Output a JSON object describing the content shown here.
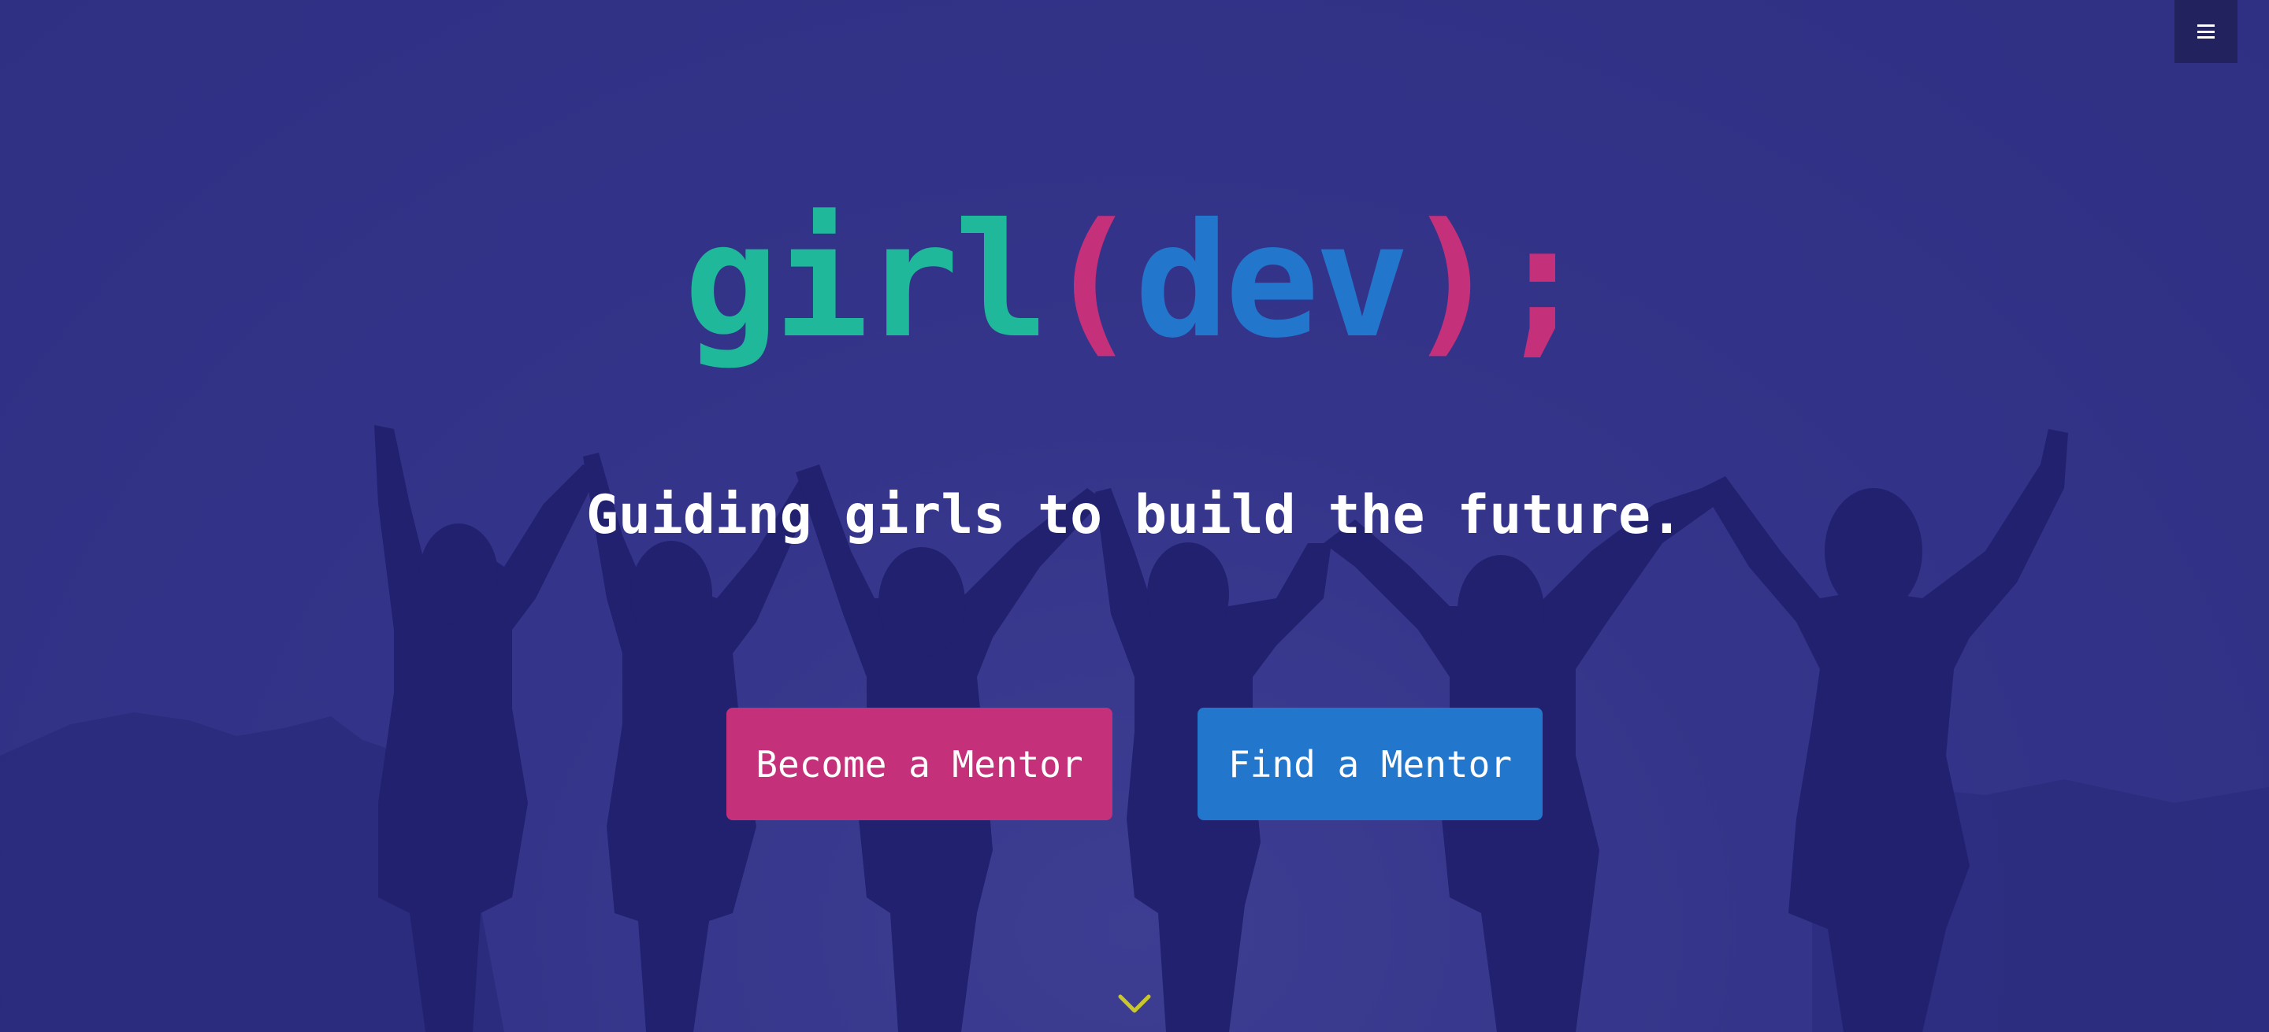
{
  "colors": {
    "green": "#1fb89a",
    "pink": "#c4307a",
    "blue": "#2276cc",
    "background": "#33338a",
    "silhouette": "#21216f",
    "menu_bg": "#22225f",
    "chevron": "#c8c82a"
  },
  "header": {
    "menu_icon": "hamburger-menu-icon"
  },
  "logo": {
    "part1": "girl",
    "open_paren": "(",
    "part2": "dev",
    "close_paren": ")",
    "semicolon": ";"
  },
  "hero": {
    "tagline": "Guiding girls to build the future.",
    "become_mentor_label": "Become a Mentor",
    "find_mentor_label": "Find a Mentor",
    "scroll_icon": "chevron-down-icon"
  }
}
